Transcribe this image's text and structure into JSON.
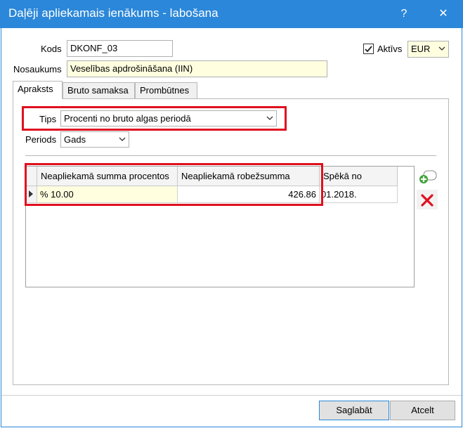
{
  "window": {
    "title": "Daļēji apliekamais ienākums - labošana",
    "help_glyph": "?",
    "close_glyph": "✕"
  },
  "form": {
    "kods_label": "Kods",
    "kods_value": "DKONF_03",
    "nosaukums_label": "Nosaukums",
    "nosaukums_value": "Veselības apdrošināšana (IIN)",
    "aktivs_label": "Aktīvs",
    "aktivs_checked": true,
    "currency": "EUR"
  },
  "tabs": [
    {
      "label": "Apraksts",
      "active": true
    },
    {
      "label": "Bruto samaksa",
      "active": false
    },
    {
      "label": "Prombūtnes",
      "active": false
    }
  ],
  "apraksts": {
    "tips_label": "Tips",
    "tips_value": "Procenti no bruto algas periodā",
    "periods_label": "Periods",
    "periods_value": "Gads"
  },
  "grid": {
    "columns": [
      "Neapliekamā summa procentos",
      "Neapliekamā robežsumma",
      "Spēkā no"
    ],
    "rows": [
      {
        "procenti": "% 10.00",
        "robezsumma": "426.86",
        "speka_no": "01.2018."
      }
    ]
  },
  "buttons": {
    "save": "Saglabāt",
    "cancel": "Atcelt"
  },
  "colors": {
    "titlebar": "#2b87d9",
    "highlight": "#e0101f",
    "add_icon": "#3aa335",
    "delete_icon": "#e0101f",
    "input_yellow": "#ffffe0"
  }
}
